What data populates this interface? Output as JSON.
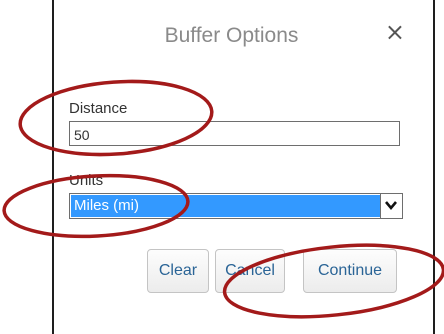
{
  "dialog": {
    "title": "Buffer Options",
    "close_glyph": "×"
  },
  "distance": {
    "label": "Distance",
    "value": "50"
  },
  "units": {
    "label": "Units",
    "selected": "Miles (mi)"
  },
  "buttons": {
    "clear": "Clear",
    "cancel": "Cancel",
    "continue": "Continue"
  },
  "colors": {
    "selection": "#3399ff",
    "link_text": "#2a6496",
    "annotation": "#a31a1a"
  }
}
